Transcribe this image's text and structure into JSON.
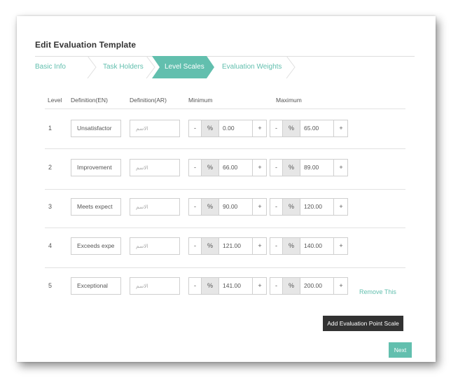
{
  "page": {
    "title": "Edit Evaluation Template",
    "accent_color": "#62bfae",
    "dark_button_color": "#323232"
  },
  "steps": [
    {
      "label": "Basic Info",
      "active": false
    },
    {
      "label": "Task Holders",
      "active": false
    },
    {
      "label": "Level Scales",
      "active": true
    },
    {
      "label": "Evaluation Weights",
      "active": false
    }
  ],
  "table": {
    "headers": {
      "level": "Level",
      "def_en": "Definition(EN)",
      "def_ar": "Definition(AR)",
      "minimum": "Minimum",
      "maximum": "Maximum"
    },
    "rows": [
      {
        "level": "1",
        "def_en": "Unsatisfactor",
        "def_ar": "الاسم",
        "min_minus": "-",
        "min_pct": "%",
        "min": "0.00",
        "min_plus": "+",
        "max_minus": "-",
        "max_pct": "%",
        "max": "65.00",
        "max_plus": "+"
      },
      {
        "level": "2",
        "def_en": "Improvement",
        "def_ar": "الاسم",
        "min_minus": "-",
        "min_pct": "%",
        "min": "66.00",
        "min_plus": "+",
        "max_minus": "-",
        "max_pct": "%",
        "max": "89.00",
        "max_plus": "+"
      },
      {
        "level": "3",
        "def_en": "Meets expect",
        "def_ar": "الاسم",
        "min_minus": "-",
        "min_pct": "%",
        "min": "90.00",
        "min_plus": "+",
        "max_minus": "-",
        "max_pct": "%",
        "max": "120.00",
        "max_plus": "+"
      },
      {
        "level": "4",
        "def_en": "Exceeds expe",
        "def_ar": "الاسم",
        "min_minus": "-",
        "min_pct": "%",
        "min": "121.00",
        "min_plus": "+",
        "max_minus": "-",
        "max_pct": "%",
        "max": "140.00",
        "max_plus": "+"
      },
      {
        "level": "5",
        "def_en": "Exceptional",
        "def_ar": "الاسم",
        "min_minus": "-",
        "min_pct": "%",
        "min": "141.00",
        "min_plus": "+",
        "max_minus": "-",
        "max_pct": "%",
        "max": "200.00",
        "max_plus": "+"
      }
    ],
    "remove_label": "Remove This"
  },
  "actions": {
    "add_label": "Add Evaluation Point Scale",
    "next_label": "Next"
  }
}
